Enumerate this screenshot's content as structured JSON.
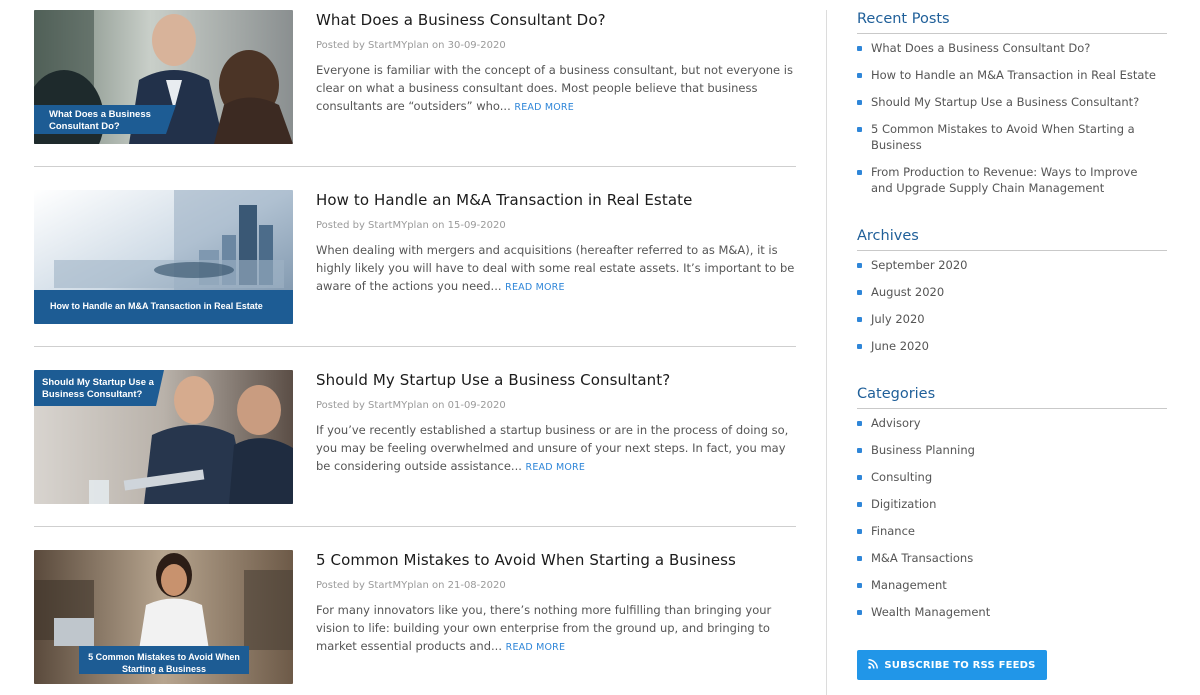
{
  "colors": {
    "accent": "#2f86d8",
    "heading": "#1f5f99",
    "rss_button": "#2196e8",
    "banner": "#1d5c94"
  },
  "posts": [
    {
      "title": "What Does a Business Consultant Do?",
      "meta": "Posted by StartMYplan on 30-09-2020",
      "excerpt": "Everyone is familiar with the concept of a business consultant, but not everyone is clear on what a business consultant does. Most people believe that business consultants are “outsiders” who...",
      "read_more": "READ MORE",
      "banner": "What Does a Business Consultant Do?"
    },
    {
      "title": "How to Handle an M&A Transaction in Real Estate",
      "meta": "Posted by StartMYplan on 15-09-2020",
      "excerpt": "When dealing with mergers and acquisitions (hereafter referred to as M&A), it is highly likely you will have to deal with some real estate assets. It’s important to be aware of the actions you need...",
      "read_more": "READ MORE",
      "banner": "How to Handle an M&A Transaction in Real Estate"
    },
    {
      "title": "Should My Startup Use a Business Consultant?",
      "meta": "Posted by StartMYplan on 01-09-2020",
      "excerpt": "If you’ve recently established a startup business or are in the process of doing so, you may be feeling overwhelmed and unsure of your next steps. In fact, you may be considering outside assistance...",
      "read_more": "READ MORE",
      "banner": "Should My Startup Use a Business Consultant?"
    },
    {
      "title": "5 Common Mistakes to Avoid When Starting a Business",
      "meta": "Posted by StartMYplan on 21-08-2020",
      "excerpt": "For many innovators like you, there’s nothing more fulfilling than bringing your vision to life: building your own enterprise from the ground up, and bringing to market essential products and...",
      "read_more": "READ MORE",
      "banner": "5 Common Mistakes to Avoid When Starting a Business"
    }
  ],
  "sidebar": {
    "recent_posts": {
      "title": "Recent Posts",
      "items": [
        "What Does a Business Consultant Do?",
        "How to Handle an M&A Transaction in Real Estate",
        "Should My Startup Use a Business Consultant?",
        "5 Common Mistakes to Avoid When Starting a Business",
        "From Production to Revenue: Ways to Improve and Upgrade Supply Chain Management"
      ]
    },
    "archives": {
      "title": "Archives",
      "items": [
        "September 2020",
        "August 2020",
        "July 2020",
        "June 2020"
      ]
    },
    "categories": {
      "title": "Categories",
      "items": [
        "Advisory",
        "Business Planning",
        "Consulting",
        "Digitization",
        "Finance",
        "M&A Transactions",
        "Management",
        "Wealth Management"
      ]
    },
    "rss_button": "SUBSCRIBE TO RSS FEEDS",
    "rss_icon": "rss-icon"
  }
}
